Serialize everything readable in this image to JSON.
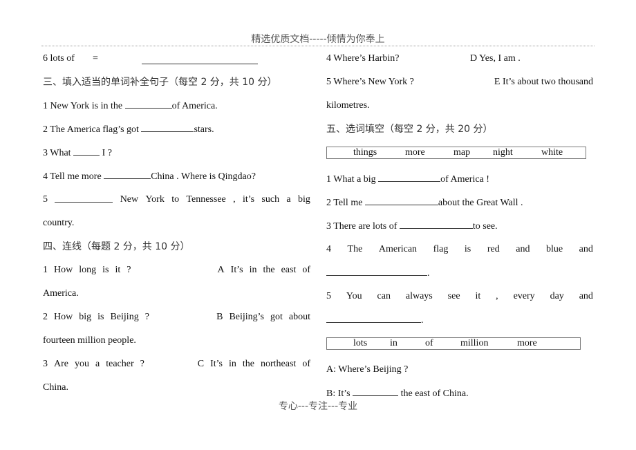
{
  "header": {
    "text": "精选优质文档-----倾情为你奉上"
  },
  "footer": {
    "text": "专心---专注---专业"
  },
  "left": {
    "row6": {
      "label": "6 lots of",
      "eq": "="
    },
    "section3": {
      "title": "三、填入适当的单词补全句子（每空 2 分，共 10 分）",
      "items": [
        {
          "num": "1",
          "before": "New York is in the",
          "after": "of America."
        },
        {
          "num": "2",
          "before": "The America flag’s got",
          "after": "stars."
        },
        {
          "num": "3",
          "before": "What",
          "after": "I ?"
        },
        {
          "num": "4",
          "before": "Tell me more",
          "after": "China . Where is Qingdao?"
        },
        {
          "num": "5",
          "words": [
            "New",
            "York",
            "to",
            "Tennessee",
            ",",
            "it’s",
            "such",
            "a",
            "big"
          ],
          "continuation": "country."
        }
      ]
    },
    "section4": {
      "title": "四、连线（每题 2 分，共 10 分）",
      "pairs": [
        {
          "q": [
            "1",
            "How",
            "long",
            "is",
            "it",
            "?"
          ],
          "a": [
            "A",
            "It’s",
            "in",
            "the",
            "east",
            "of"
          ],
          "cont": "America."
        },
        {
          "q": [
            "2",
            "How",
            "big",
            "is",
            "Beijing",
            "?"
          ],
          "a": [
            "B",
            "Beijing’s",
            "got",
            "about"
          ],
          "cont": "fourteen million people."
        },
        {
          "q": [
            "3",
            "Are",
            "you",
            "a",
            "teacher",
            "?"
          ],
          "a": [
            "C",
            "It’s",
            "in",
            "the",
            "northeast",
            "of"
          ],
          "cont": "China."
        }
      ]
    }
  },
  "right": {
    "section4_cont": [
      {
        "q": "4 Where’s Harbin?",
        "a": "D Yes, I am ."
      },
      {
        "q": "5 Where’s New York ?",
        "a": "E It’s about two thousand",
        "cont": "kilometres."
      }
    ],
    "section5": {
      "title": "五、选词填空（每空 2  分，共 20 分）",
      "wordbox1": [
        "things",
        "more",
        "map",
        "night",
        "white"
      ],
      "items": [
        {
          "num": "1",
          "before": "What a big",
          "after": "of America !"
        },
        {
          "num": "2",
          "before": "Tell me",
          "after": "about the Great Wall ."
        },
        {
          "num": "3",
          "before": "There are lots of",
          "after": "to see."
        },
        {
          "words": [
            "4",
            "The",
            "American",
            "flag",
            "is",
            "red",
            "and",
            "blue",
            "and"
          ],
          "end": "."
        },
        {
          "words": [
            "5",
            "You",
            "can",
            "always",
            "see",
            "it",
            ",",
            "every",
            "day",
            "and"
          ],
          "end": "."
        }
      ],
      "wordbox2": [
        "lots",
        "in",
        "of",
        "million",
        "more"
      ],
      "dialog": [
        {
          "text": "A: Where’s Beijing ?"
        },
        {
          "before": "B: It’s",
          "after": "the east of China."
        }
      ]
    }
  }
}
